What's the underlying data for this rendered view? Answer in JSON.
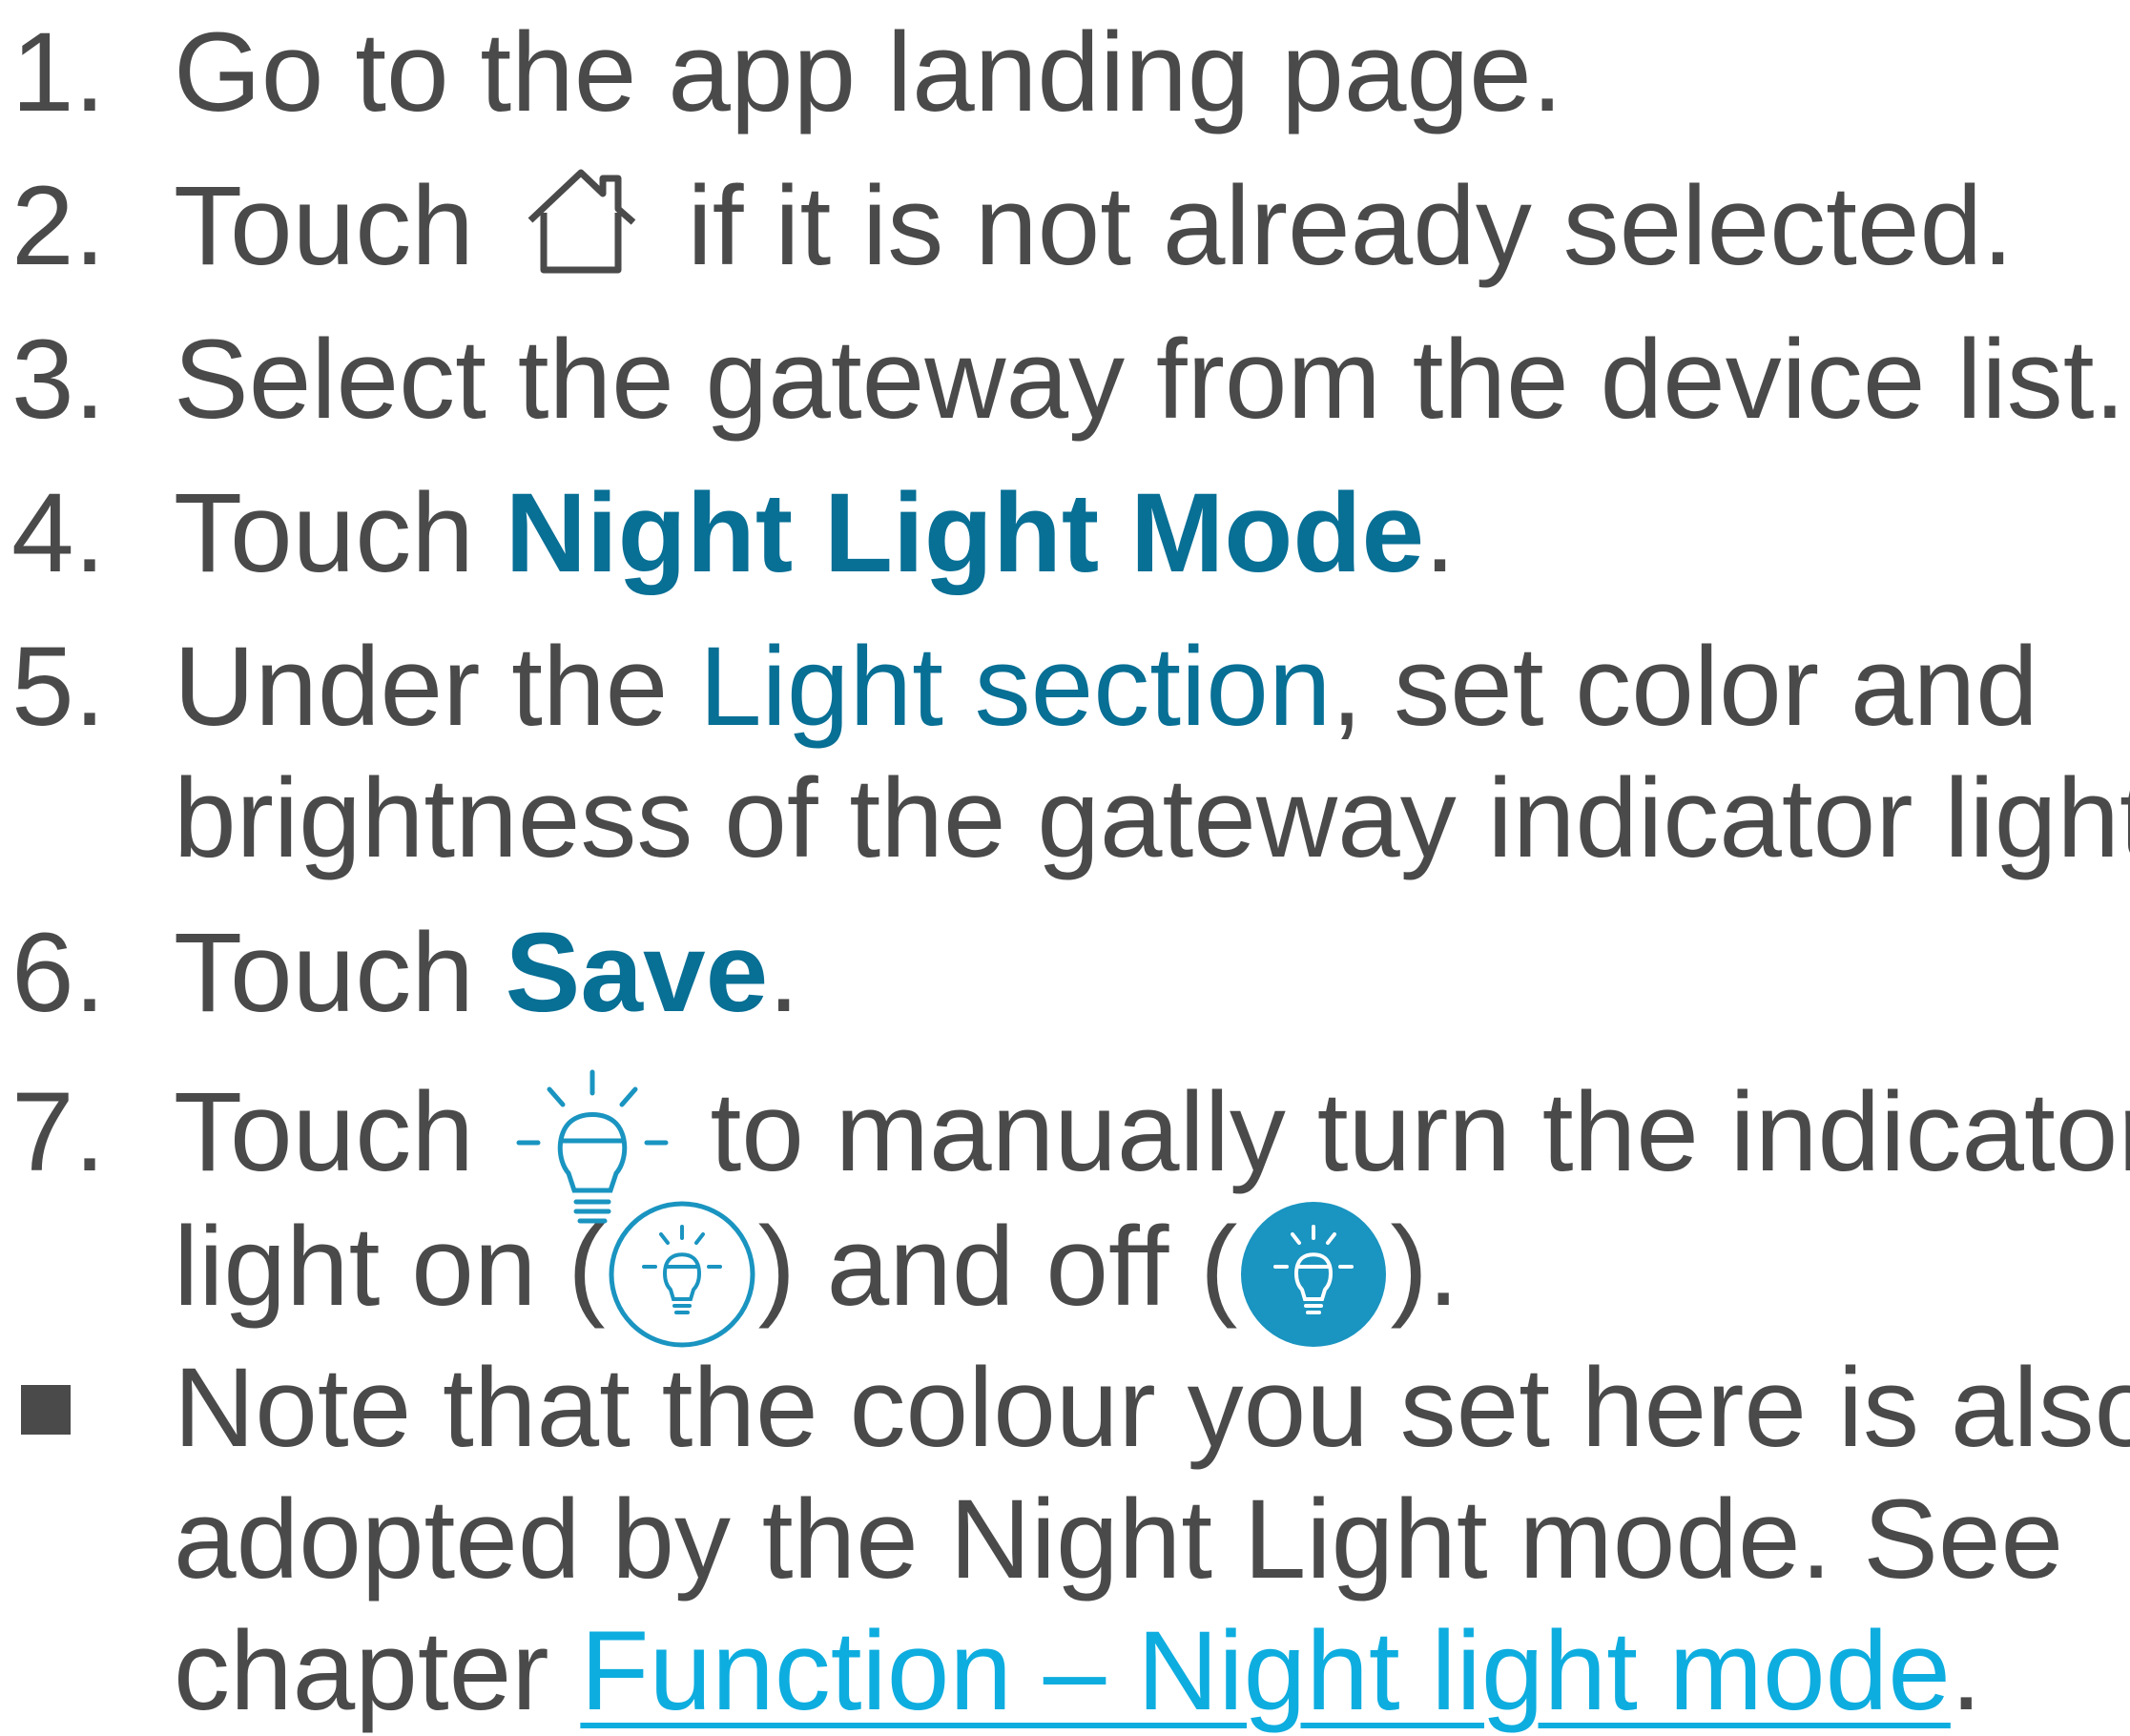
{
  "steps": [
    {
      "marker": "1.",
      "text": "Go to the app landing page."
    },
    {
      "marker": "2.",
      "pre": "Touch",
      "icon": "home-icon",
      "post": "if it is not already selected."
    },
    {
      "marker": "3.",
      "text": "Select the gateway from the device list."
    },
    {
      "marker": "4.",
      "pre": "Touch ",
      "emph": "Night Light Mode",
      "post": "."
    },
    {
      "marker": "5.",
      "pre": "Under the ",
      "emph": "Light section",
      "post": ", set color and",
      "cont": "brightness of the gateway indicator light."
    },
    {
      "marker": "6.",
      "pre": "Touch ",
      "emph": "Save",
      "post": "."
    },
    {
      "marker": "7.",
      "pre": "Touch",
      "icon": "lightbulb-icon",
      "post": "to manually turn the indicator",
      "cont_pre": "light on (",
      "cont_icon_on": "lightbulb-outline-circle-icon",
      "cont_mid": ") and off (",
      "cont_icon_off": "lightbulb-filled-circle-icon",
      "cont_post": ")."
    }
  ],
  "note": {
    "marker_icon": "square-bullet-icon",
    "line1": "Note that the colour you set here is also",
    "line2": "adopted by the Night Light mode. See",
    "line3_pre": "chapter ",
    "link": "Function – Night light mode",
    "line3_post": "."
  },
  "colors": {
    "text": "#4a4a4a",
    "emphasis": "#086f95",
    "link": "#0eaddf",
    "icon": "#1a94c0"
  }
}
